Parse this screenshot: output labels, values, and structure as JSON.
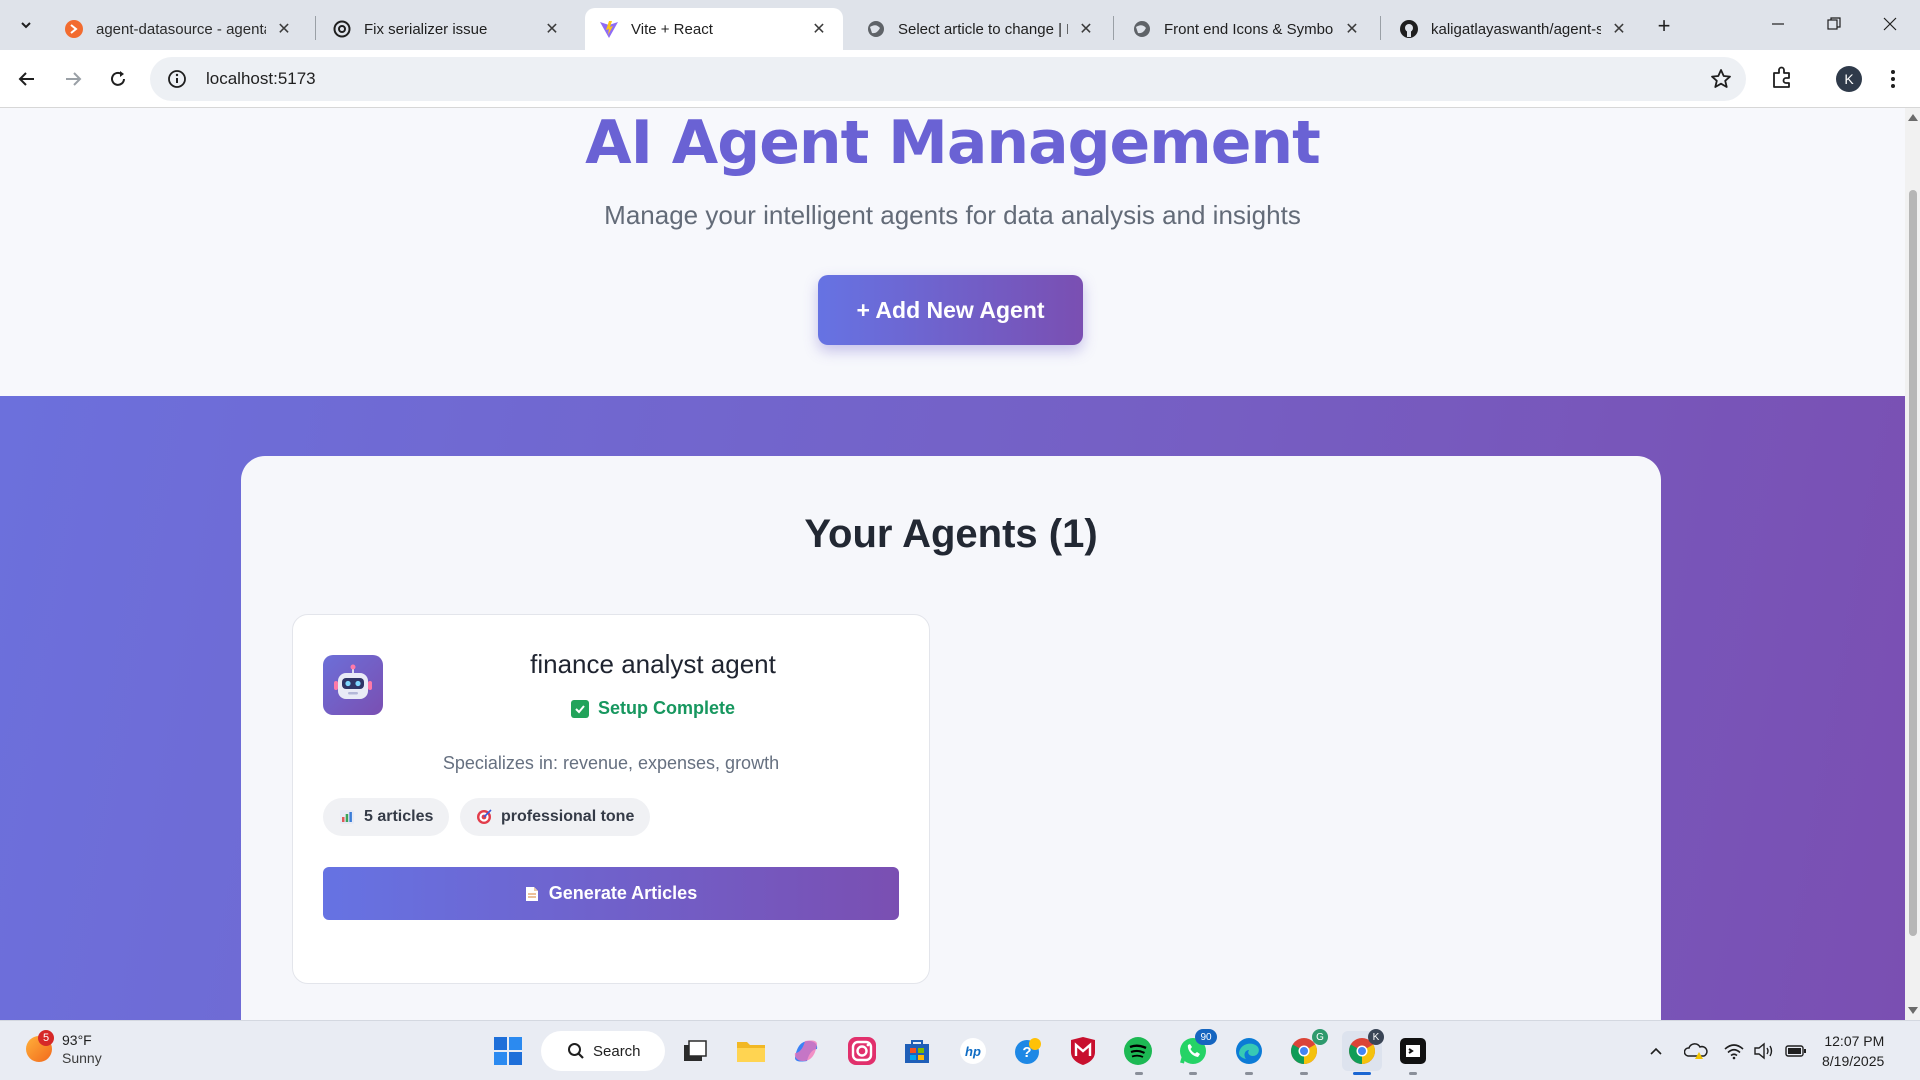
{
  "browser": {
    "tabs": [
      {
        "title": "agent-datasource - agenta",
        "favicon": "orange-logo-icon",
        "active": false
      },
      {
        "title": "Fix serializer issue",
        "favicon": "openai-icon",
        "active": false
      },
      {
        "title": "Vite + React",
        "favicon": "vite-icon",
        "active": true
      },
      {
        "title": "Select article to change | D",
        "favicon": "globe-icon",
        "active": false
      },
      {
        "title": "Front end Icons & Symbols",
        "favicon": "globe-icon",
        "active": false
      },
      {
        "title": "kaligatlayaswanth/agent-s",
        "favicon": "github-icon",
        "active": false
      }
    ],
    "url": "localhost:5173",
    "profile_initial": "K"
  },
  "page": {
    "title": "AI Agent Management",
    "subtitle": "Manage your intelligent agents for data analysis and insights",
    "add_button": "+ Add New Agent",
    "agents_heading": "Your Agents (1)",
    "accent_color": "#6a62d4",
    "gradient": [
      "#6673e3",
      "#7a4fb2"
    ],
    "agents": [
      {
        "name": "finance analyst agent",
        "status": "Setup Complete",
        "specializes": "Specializes in: revenue, expenses, growth",
        "articles_chip": "5 articles",
        "tone_chip": "professional tone",
        "generate_button": "Generate Articles",
        "avatar_icon": "robot-icon"
      }
    ]
  },
  "taskbar": {
    "weather": {
      "temp": "93°F",
      "condition": "Sunny",
      "badge": "5"
    },
    "search_label": "Search",
    "whatsapp_badge": "90",
    "chrome_badge": "G",
    "chrome_profile_badge": "K",
    "time": "12:07 PM",
    "date": "8/19/2025"
  }
}
